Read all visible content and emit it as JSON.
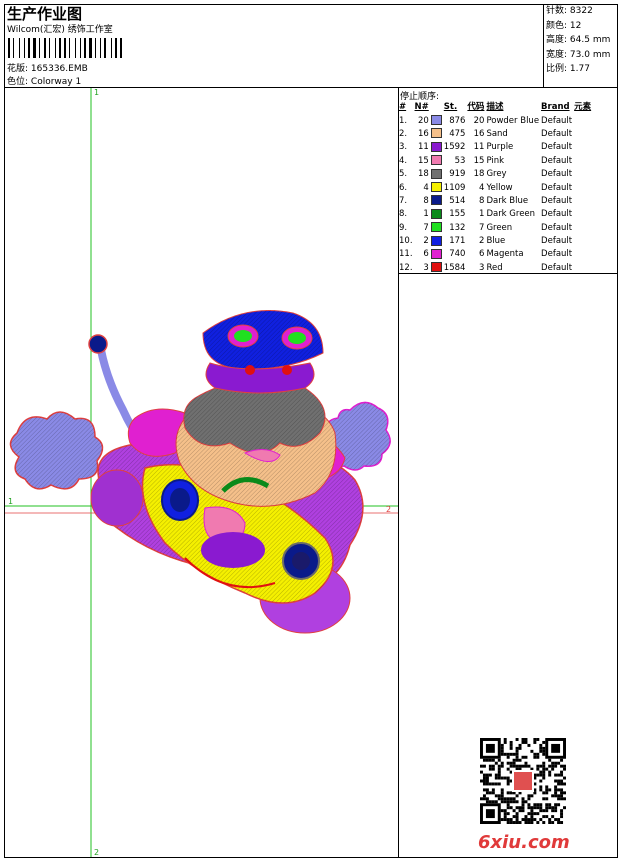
{
  "header": {
    "title": "生产作业图",
    "subtitle": "Wilcom(汇宏) 绣饰工作室",
    "design_label": "花版:",
    "design_value": "165336.EMB",
    "colorway_label": "色位:",
    "colorway_value": "Colorway 1"
  },
  "stats": [
    {
      "label": "针数:",
      "value": "8322"
    },
    {
      "label": "颜色:",
      "value": "12"
    },
    {
      "label": "高度:",
      "value": "64.5 mm"
    },
    {
      "label": "宽度:",
      "value": "73.0 mm"
    },
    {
      "label": "比例:",
      "value": "1.77"
    }
  ],
  "color_list": {
    "title": "停止顺序:",
    "headers": [
      "#",
      "N#",
      "St.",
      "代码",
      "描述",
      "Brand",
      "元素"
    ],
    "rows": [
      {
        "idx": "1.",
        "n": "20",
        "color": "#8a8ae6",
        "st": "876",
        "code": "20",
        "desc": "Powder Blue",
        "brand": "Default"
      },
      {
        "idx": "2.",
        "n": "16",
        "color": "#f5c08a",
        "st": "475",
        "code": "16",
        "desc": "Sand",
        "brand": "Default"
      },
      {
        "idx": "3.",
        "n": "11",
        "color": "#8a1ad0",
        "st": "1592",
        "code": "11",
        "desc": "Purple",
        "brand": "Default"
      },
      {
        "idx": "4.",
        "n": "15",
        "color": "#f07ab0",
        "st": "53",
        "code": "15",
        "desc": "Pink",
        "brand": "Default"
      },
      {
        "idx": "5.",
        "n": "18",
        "color": "#707070",
        "st": "919",
        "code": "18",
        "desc": "Grey",
        "brand": "Default"
      },
      {
        "idx": "6.",
        "n": "4",
        "color": "#f5f000",
        "st": "1109",
        "code": "4",
        "desc": "Yellow",
        "brand": "Default"
      },
      {
        "idx": "7.",
        "n": "8",
        "color": "#0a1a8a",
        "st": "514",
        "code": "8",
        "desc": "Dark Blue",
        "brand": "Default"
      },
      {
        "idx": "8.",
        "n": "1",
        "color": "#0a8a1a",
        "st": "155",
        "code": "1",
        "desc": "Dark Green",
        "brand": "Default"
      },
      {
        "idx": "9.",
        "n": "7",
        "color": "#20e020",
        "st": "132",
        "code": "7",
        "desc": "Green",
        "brand": "Default"
      },
      {
        "idx": "10.",
        "n": "2",
        "color": "#1020e0",
        "st": "171",
        "code": "2",
        "desc": "Blue",
        "brand": "Default"
      },
      {
        "idx": "11.",
        "n": "6",
        "color": "#e020d0",
        "st": "740",
        "code": "6",
        "desc": "Magenta",
        "brand": "Default"
      },
      {
        "idx": "12.",
        "n": "3",
        "color": "#e01010",
        "st": "1584",
        "code": "3",
        "desc": "Red",
        "brand": "Default"
      }
    ]
  },
  "axis_labels": {
    "v_top": "1",
    "v_bottom": "2",
    "h_left": "1",
    "h_right": "2"
  },
  "watermark": "6xiu.com"
}
